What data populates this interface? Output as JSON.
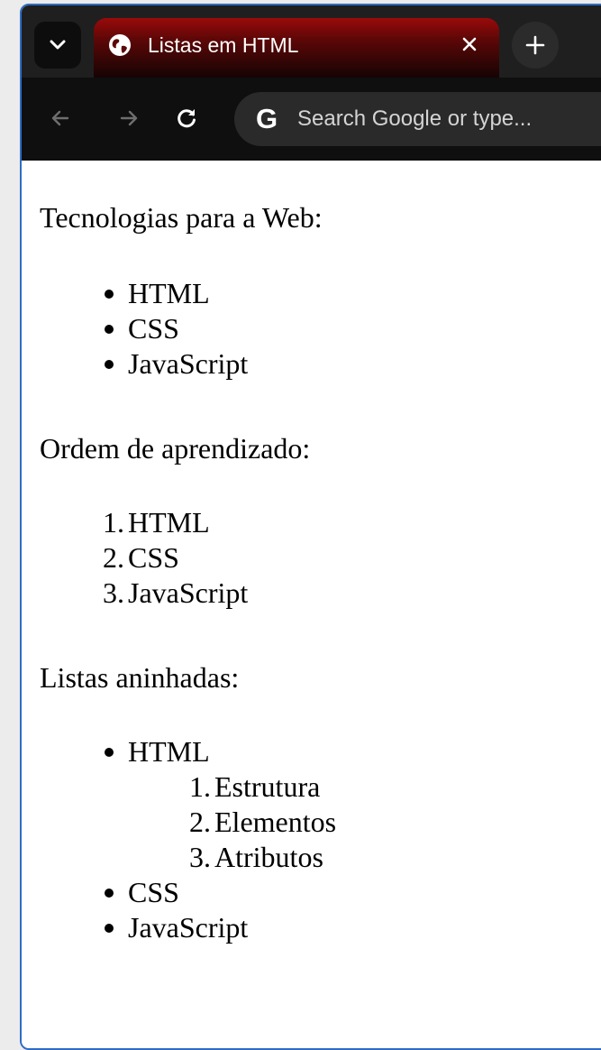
{
  "browser": {
    "tab": {
      "title": "Listas em HTML"
    },
    "omnibox": {
      "placeholder": "Search Google or type..."
    },
    "buttons": {
      "tab_search": "chevron-down-icon",
      "tab_close": "close-icon",
      "new_tab": "plus-icon",
      "back": "arrow-left-icon",
      "forward": "arrow-right-icon",
      "reload": "reload-icon"
    },
    "colors": {
      "tab_accent": "#9a0a0a",
      "window_border": "#2f6cc4",
      "toolbar_bg": "#0f0f0f"
    }
  },
  "page": {
    "section1": {
      "heading": "Tecnologias para a Web:",
      "items": [
        "HTML",
        "CSS",
        "JavaScript"
      ]
    },
    "section2": {
      "heading": "Ordem de aprendizado:",
      "markers": [
        "1.",
        "2.",
        "3."
      ],
      "items": [
        "HTML",
        "CSS",
        "JavaScript"
      ]
    },
    "section3": {
      "heading": "Listas aninhadas:",
      "items": [
        {
          "label": "HTML",
          "sub_markers": [
            "1.",
            "2.",
            "3."
          ],
          "sub_items": [
            "Estrutura",
            "Elementos",
            "Atributos"
          ]
        },
        {
          "label": "CSS"
        },
        {
          "label": "JavaScript"
        }
      ]
    }
  }
}
